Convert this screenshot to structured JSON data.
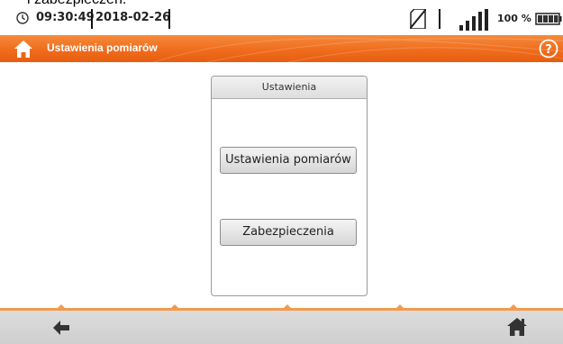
{
  "top_text": "i zabezpieczeń.",
  "status": {
    "time": "09:30:49",
    "date": "2018-02-26",
    "battery_percent": "100 %",
    "icons": [
      "clock-icon",
      "sd-card-icon",
      "signal-icon",
      "battery-icon"
    ]
  },
  "titlebar": {
    "title": "Ustawienia pomiarów",
    "icons": [
      "home-icon",
      "help-icon"
    ]
  },
  "dialog": {
    "title": "Ustawienia",
    "buttons": [
      {
        "label": "Ustawienia pomiarów"
      },
      {
        "label": "Zabezpieczenia"
      }
    ]
  },
  "bottombar": {
    "icons": [
      "back-arrow-icon",
      "home-icon"
    ]
  },
  "colors": {
    "accent": "#ef6d1c",
    "bottom_bar": "#d6d6d6"
  }
}
